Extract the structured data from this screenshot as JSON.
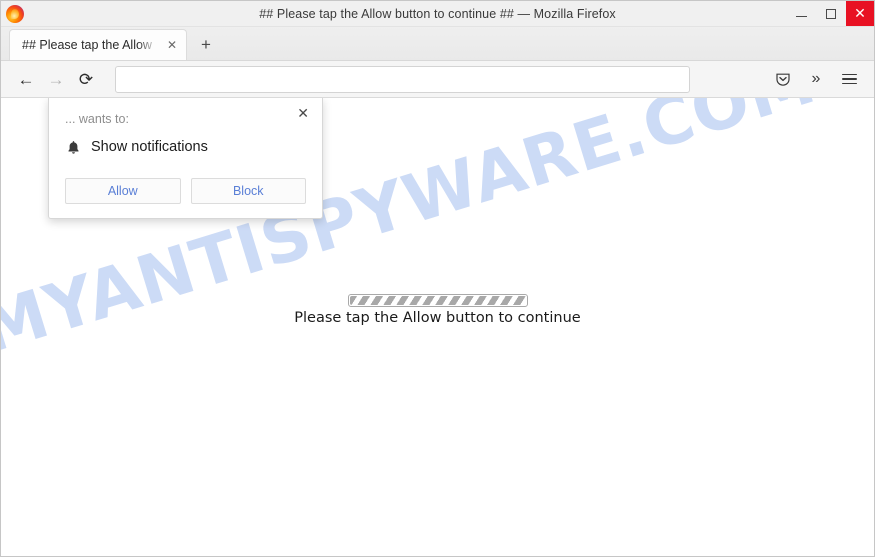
{
  "window": {
    "title": "## Please tap the Allow button to continue ## — Mozilla Firefox",
    "logo_icon": "firefox-logo",
    "controls": {
      "minimize_label": "Minimize",
      "maximize_label": "Maximize",
      "close_label": "✕"
    }
  },
  "tabbar": {
    "tabs": [
      {
        "label": "## Please tap the Allow",
        "close_label": "✕"
      }
    ],
    "new_tab_label": "+"
  },
  "navbar": {
    "back_label": "←",
    "forward_label": "→",
    "reload_label": "⟳",
    "url_value": "",
    "url_placeholder": "",
    "pocket_icon": "pocket-icon",
    "overflow_label": "»",
    "menu_icon": "hamburger-menu-icon"
  },
  "permission_dialog": {
    "origin_text": "... wants to:",
    "request_icon": "bell-icon",
    "request_label": "Show notifications",
    "allow_label": "Allow",
    "block_label": "Block",
    "close_label": "✕"
  },
  "page": {
    "watermark_text": "MYANTISPYWARE.COM",
    "message": "Please tap the Allow button to continue",
    "progress_style": "striped-indeterminate"
  },
  "colors": {
    "close_button_red": "#e81123",
    "watermark_blue": "#ccdbf6",
    "link_blue": "#5a7fd6"
  }
}
